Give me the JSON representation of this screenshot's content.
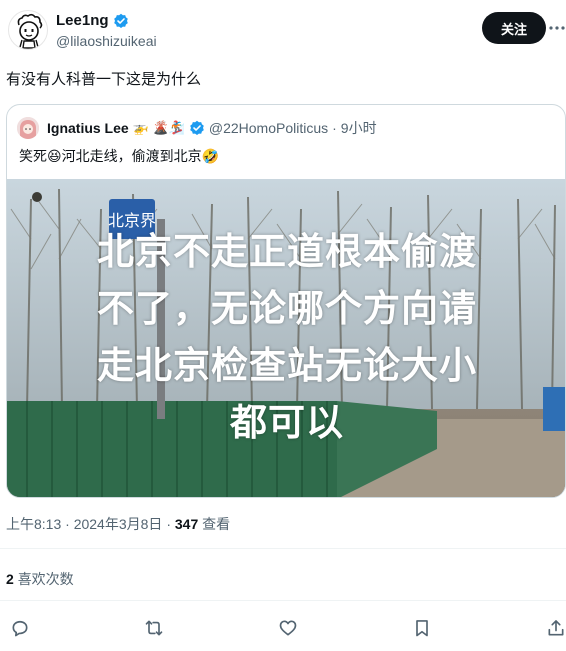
{
  "author": {
    "display_name": "Lee1ng",
    "handle": "@lilaoshizuikeai",
    "verified": true,
    "avatar_icon": "doodle-face-avatar"
  },
  "follow_button": {
    "label": "关注"
  },
  "tweet": {
    "text": "有没有人科普一下这是为什么"
  },
  "quoted": {
    "display_name": "Ignatius Lee",
    "name_emojis": "🚁 🌋🏂",
    "handle": "@22HomoPoliticus",
    "separator": "·",
    "time": "9小时",
    "text": "笑死😆河北走线，偷渡到北京🤣",
    "image": {
      "overlay_lines": [
        "北京不走正道根本偷渡",
        "不了，无论哪个方向请",
        "走北京检查站无论大小",
        "都可以"
      ],
      "sign_text": "北京界"
    }
  },
  "meta": {
    "time": "上午8:13",
    "sep1": "·",
    "date": "2024年3月8日",
    "sep2": "·",
    "views_count": "347",
    "views_label": "查看"
  },
  "likes": {
    "count": "2",
    "label": "喜欢次数"
  },
  "colors": {
    "text": "#0f1419",
    "secondary": "#536471",
    "verified": "#1d9bf0",
    "border": "#cfd9de",
    "button": "#0f1419"
  },
  "icons": [
    "verified-icon",
    "more-icon",
    "reply-icon",
    "retweet-icon",
    "like-icon",
    "bookmark-icon",
    "share-icon"
  ]
}
